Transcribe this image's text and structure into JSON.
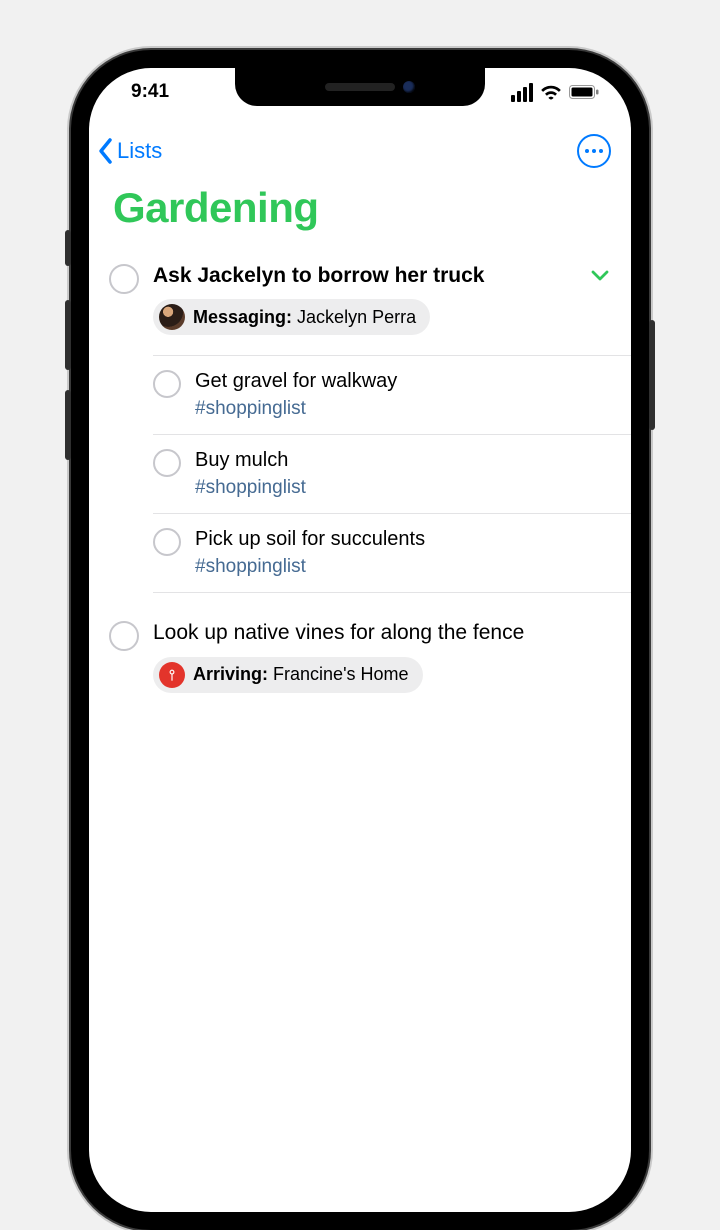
{
  "status": {
    "time": "9:41"
  },
  "nav": {
    "back": "Lists"
  },
  "title": "Gardening",
  "colors": {
    "accent": "#30c759",
    "link": "#007aff",
    "tag": "#456a92"
  },
  "reminders": [
    {
      "title": "Ask Jackelyn to borrow her truck",
      "bold": true,
      "expanded": true,
      "chip": {
        "type": "messaging",
        "label_prefix": "Messaging:",
        "label_value": "Jackelyn Perra"
      },
      "subtasks": [
        {
          "title": "Get gravel for walkway",
          "tag": "#shoppinglist"
        },
        {
          "title": "Buy mulch",
          "tag": "#shoppinglist"
        },
        {
          "title": "Pick up soil for succulents",
          "tag": "#shoppinglist"
        }
      ]
    },
    {
      "title": "Look up native vines for along the fence",
      "chip": {
        "type": "location",
        "label_prefix": "Arriving:",
        "label_value": "Francine's Home"
      }
    }
  ]
}
